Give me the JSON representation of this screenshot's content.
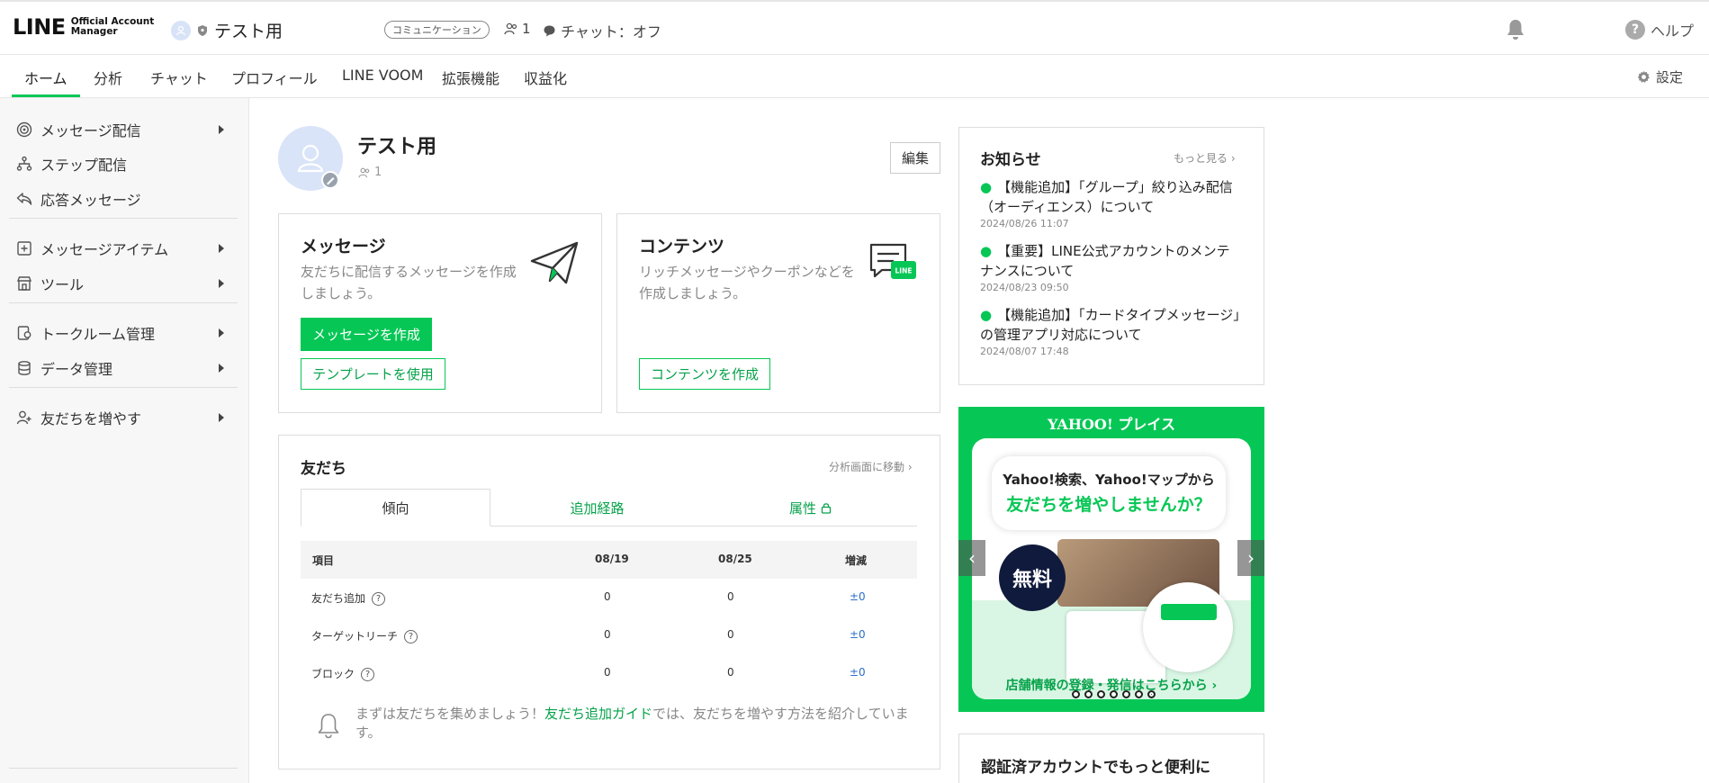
{
  "header": {
    "logo_main": "LINE",
    "logo_sub_line1": "Official Account",
    "logo_sub_line2": "Manager",
    "account_name": "テスト用",
    "badge": "コミュニケーション",
    "friend_count": "1",
    "chat_status": "チャット：オフ",
    "help_label": "ヘルプ"
  },
  "nav": {
    "tabs": [
      "ホーム",
      "分析",
      "チャット",
      "プロフィール",
      "LINE VOOM",
      "拡張機能",
      "収益化"
    ],
    "settings_label": "設定"
  },
  "sidebar": {
    "items": [
      {
        "label": "メッセージ配信",
        "icon": "broadcast-icon"
      },
      {
        "label": "ステップ配信",
        "icon": "step-icon"
      },
      {
        "label": "応答メッセージ",
        "icon": "reply-icon"
      },
      {
        "label": "メッセージアイテム",
        "icon": "message-item-icon"
      },
      {
        "label": "ツール",
        "icon": "store-icon"
      },
      {
        "label": "トークルーム管理",
        "icon": "talkroom-icon"
      },
      {
        "label": "データ管理",
        "icon": "database-icon"
      },
      {
        "label": "友だちを増やす",
        "icon": "add-friend-icon"
      }
    ]
  },
  "profile": {
    "name": "テスト用",
    "friends": "1",
    "edit_label": "編集"
  },
  "message_card": {
    "title": "メッセージ",
    "desc": "友だちに配信するメッセージを作成しましょう。",
    "primary_button": "メッセージを作成",
    "secondary_button": "テンプレートを使用"
  },
  "contents_card": {
    "title": "コンテンツ",
    "desc": "リッチメッセージやクーポンなどを作成しましょう。",
    "button": "コンテンツを作成"
  },
  "friends_card": {
    "title": "友だち",
    "link": "分析画面に移動",
    "tabs": [
      "傾向",
      "追加経路",
      "属性"
    ],
    "columns": [
      "項目",
      "08/19",
      "08/25",
      "増減"
    ],
    "rows": [
      {
        "label": "友だち追加",
        "v1": "0",
        "v2": "0",
        "diff": "±0"
      },
      {
        "label": "ターゲットリーチ",
        "v1": "0",
        "v2": "0",
        "diff": "±0"
      },
      {
        "label": "ブロック",
        "v1": "0",
        "v2": "0",
        "diff": "±0"
      }
    ],
    "tip_before": "まずは友だちを集めましょう！",
    "tip_link": "友だち追加ガイド",
    "tip_after": "では、友だちを増やす方法を紹介しています。"
  },
  "news": {
    "title": "お知らせ",
    "more": "もっと見る",
    "items": [
      {
        "text": "【機能追加】「グループ」絞り込み配信（オーディエンス）について",
        "date": "2024/08/26 11:07"
      },
      {
        "text": "【重要】LINE公式アカウントのメンテナンスについて",
        "date": "2024/08/23 09:50"
      },
      {
        "text": "【機能追加】「カードタイプメッセージ」の管理アプリ対応について",
        "date": "2024/08/07 17:48"
      }
    ]
  },
  "banner": {
    "brand": "YAHOO! プレイス",
    "line1": "Yahoo!検索、Yahoo!マップから",
    "line2": "友だちを増やしませんか？",
    "free": "無料",
    "footer": "店舗情報の登録・発信はこちらから",
    "slide_count": 7
  },
  "cert": {
    "title": "認証済アカウントでもっと便利に"
  },
  "colors": {
    "accent": "#06c755",
    "link_blue": "#2b6fc9"
  }
}
